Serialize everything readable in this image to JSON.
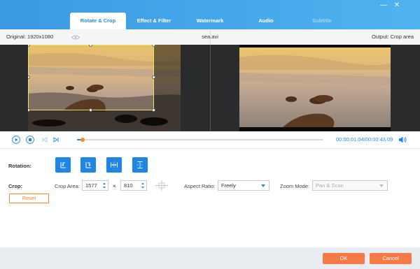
{
  "window": {
    "minimize_glyph": "—",
    "close_glyph": "✕"
  },
  "tabs": [
    {
      "label": "Rotate & Crop",
      "state": "active"
    },
    {
      "label": "Effect & Filter",
      "state": "normal"
    },
    {
      "label": "Watermark",
      "state": "normal"
    },
    {
      "label": "Audio",
      "state": "normal"
    },
    {
      "label": "Subtitle",
      "state": "disabled"
    }
  ],
  "info": {
    "original": "Original: 1920x1080",
    "filename": "sea.avi",
    "output": "Output: Crop area"
  },
  "player": {
    "progress": 0.024,
    "current_time": "00:00:01.04",
    "separator": "/",
    "total_time": "00:00:43.09"
  },
  "rotation": {
    "label": "Rotation:",
    "buttons": [
      "rotate-left",
      "rotate-right",
      "flip-horizontal",
      "flip-vertical"
    ]
  },
  "crop": {
    "label": "Crop:",
    "area_label": "Crop Area:",
    "width": "1577",
    "times": "×",
    "height": "810",
    "aspect_label": "Aspect Ratio:",
    "aspect_value": "Freely",
    "zoom_label": "Zoom Mode:",
    "zoom_value": "Pan & Scan",
    "reset_label": "Reset"
  },
  "footer": {
    "ok_label": "OK",
    "cancel_label": "Cancel"
  },
  "colors": {
    "accent": "#1f86e6",
    "orange": "#f47a47",
    "header": "#3a9ae2"
  }
}
